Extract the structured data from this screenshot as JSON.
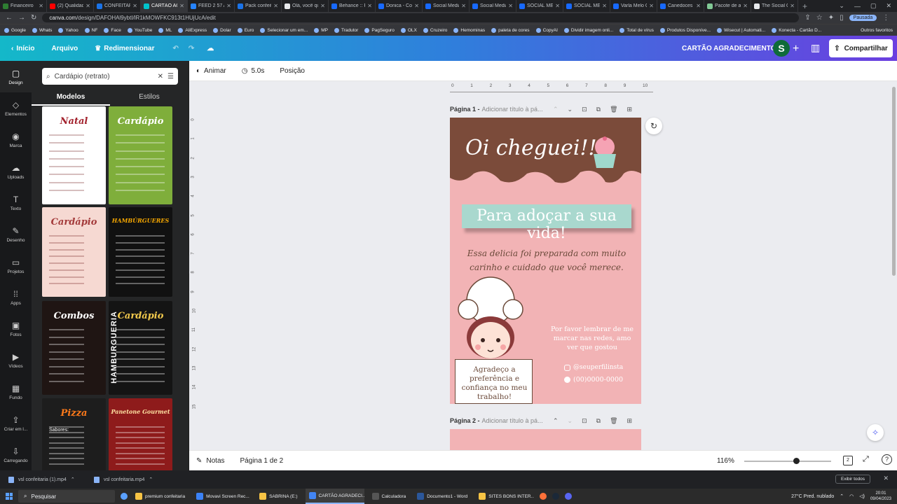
{
  "browser": {
    "tabs": [
      {
        "label": "Financeiro",
        "color": "#2e7d32"
      },
      {
        "label": "(2) Qualidade",
        "color": "#ff0000"
      },
      {
        "label": "CONFEITARIA",
        "color": "#1a73e8"
      },
      {
        "label": "CARTÃO AG",
        "color": "#00c4cc"
      },
      {
        "label": "FEED 2 57 A",
        "color": "#2684ff"
      },
      {
        "label": "Pack confeit",
        "color": "#1a73e8"
      },
      {
        "label": "Olá, você qu",
        "color": "#e8eaed"
      },
      {
        "label": "Behance :: P",
        "color": "#1769ff"
      },
      {
        "label": "Donica - Con",
        "color": "#1769ff"
      },
      {
        "label": "Social Media",
        "color": "#1769ff"
      },
      {
        "label": "Social Media",
        "color": "#1769ff"
      },
      {
        "label": "SOCIAL MED",
        "color": "#1769ff"
      },
      {
        "label": "SOCIAL MED",
        "color": "#1769ff"
      },
      {
        "label": "Varla Melo C",
        "color": "#1769ff"
      },
      {
        "label": "Canedoces",
        "color": "#1769ff"
      },
      {
        "label": "Pacote de ar",
        "color": "#81c995"
      },
      {
        "label": "The Social C",
        "color": "#e8eaed"
      }
    ],
    "active_tab": 3,
    "url_domain": "canva.com",
    "url_path": "/design/DAFOHAl9ybtI/lR1kMOWFKC913t1HUjUcA/edit",
    "profile_status": "Pausada",
    "bookmarks": [
      "Google",
      "Whats",
      "Yahoo",
      "NF",
      "Face",
      "YouTube",
      "ML",
      "AliExpress",
      "Dolar",
      "Euro",
      "Selecionar um em...",
      "MP",
      "Tradutor",
      "PagSeguro",
      "OLX",
      "Cruzeiro",
      "Hemominas",
      "paleta de cores",
      "CopyAI",
      "Dividir imagem onli...",
      "Total de vírus",
      "Produtos Disponíve...",
      "Wisecut | Automati...",
      "Konecta - Cartão D..."
    ],
    "bookmarks_all": "Outros favoritos"
  },
  "header": {
    "home": "Início",
    "file": "Arquivo",
    "resize": "Redimensionar",
    "doc_title": "CARTÃO AGRADECIMENTO",
    "avatar_initial": "S",
    "share": "Compartilhar"
  },
  "rail": [
    {
      "label": "Design",
      "icon": "▢"
    },
    {
      "label": "Elementos",
      "icon": "◇"
    },
    {
      "label": "Marca",
      "icon": "◉"
    },
    {
      "label": "Uploads",
      "icon": "☁"
    },
    {
      "label": "Texto",
      "icon": "T"
    },
    {
      "label": "Desenho",
      "icon": "✎"
    },
    {
      "label": "Projetos",
      "icon": "▭"
    },
    {
      "label": "Apps",
      "icon": "⁞⁞"
    },
    {
      "label": "Fotos",
      "icon": "▣"
    },
    {
      "label": "Vídeos",
      "icon": "▶"
    },
    {
      "label": "Fundo",
      "icon": "▦"
    },
    {
      "label": "Criar em l...",
      "icon": "⇪"
    },
    {
      "label": "Carregando",
      "icon": "⇩"
    }
  ],
  "panel": {
    "search_value": "Cardápio (retrato)",
    "tabs": [
      "Modelos",
      "Estilos"
    ],
    "templates": [
      {
        "title": "Natal",
        "bg": "#ffffff",
        "fg": "#a3232e"
      },
      {
        "title": "Cardápio",
        "bg": "#7fae3b",
        "fg": "#ffffff"
      },
      {
        "title": "Cardápio",
        "bg": "#f6d9d2",
        "fg": "#a33a3a"
      },
      {
        "title": "HAMBÚRGUERES",
        "bg": "#111111",
        "fg": "#f6a700"
      },
      {
        "title": "Combos",
        "bg": "#1f1513",
        "fg": "#ffffff"
      },
      {
        "title": "Cardápio",
        "bg": "#141414",
        "fg": "#f2c94c"
      },
      {
        "title": "Pizza",
        "bg": "#1d1d1d",
        "fg": "#ff7a1a"
      },
      {
        "title": "Panetone Gourmet",
        "bg": "#8e1b1b",
        "fg": "#ffe3a3"
      }
    ],
    "template_extra": {
      "side_text": "HAMBURGUERIA",
      "pizza_label": "Sabores:"
    }
  },
  "toolbar": {
    "animate": "Animar",
    "duration": "5.0s",
    "position": "Posição"
  },
  "pages": [
    {
      "label": "Página 1 -",
      "subtitle": "Adicionar título à pá..."
    },
    {
      "label": "Página 2 -",
      "subtitle": "Adicionar título à pá..."
    }
  ],
  "ruler_ticks": [
    "0",
    "1",
    "2",
    "3",
    "4",
    "5",
    "6",
    "7",
    "8",
    "9",
    "10"
  ],
  "ruler_v_ticks": [
    "0",
    "1",
    "2",
    "3",
    "4",
    "5",
    "6",
    "7",
    "8",
    "9",
    "10",
    "11",
    "12",
    "13",
    "14",
    "15"
  ],
  "card": {
    "headline": "Oi cheguei!!!",
    "tagline": "Para adoçar a sua vida!",
    "description": "Essa delicia foi preparada com muito carinho e cuidado que você merece.",
    "remember": "Por favor lembrar de me marcar nas redes, amo ver que gostou",
    "instagram": "@seuperfilinsta",
    "phone": "(00)0000-0000",
    "thanks": "Agradeço a preferência e confiança no meu trabalho!",
    "colors": {
      "brown": "#7b4b3a",
      "pink": "#f2b3b5",
      "mint": "#a9d8ce"
    }
  },
  "bottom": {
    "notes": "Notas",
    "page_info": "Página 1 de 2",
    "zoom": "116%",
    "pages_count": "2",
    "zoom_fraction": 0.6
  },
  "downloads": {
    "items": [
      "vsl confeitaria (1).mp4",
      "vsl confeitaria.mp4"
    ],
    "show_all": "Exibir todos"
  },
  "taskbar": {
    "search": "Pesquisar",
    "apps": [
      {
        "label": "premium confeitaria",
        "color": "#f6c344"
      },
      {
        "label": "Movavi Screen Rec...",
        "color": "#3b82f6"
      },
      {
        "label": "SABRINA (E:)",
        "color": "#f6c344"
      },
      {
        "label": "CARTÃO AGRADECI...",
        "color": "#4285f4"
      },
      {
        "label": "Calculadora",
        "color": "#555555"
      },
      {
        "label": "Documento1 - Word",
        "color": "#2b579a"
      },
      {
        "label": "SITES BONS INTER...",
        "color": "#f6c344"
      }
    ],
    "active_app": 3,
    "weather": "27°C Pred. nublado",
    "time": "20:01",
    "date": "09/04/2023"
  }
}
